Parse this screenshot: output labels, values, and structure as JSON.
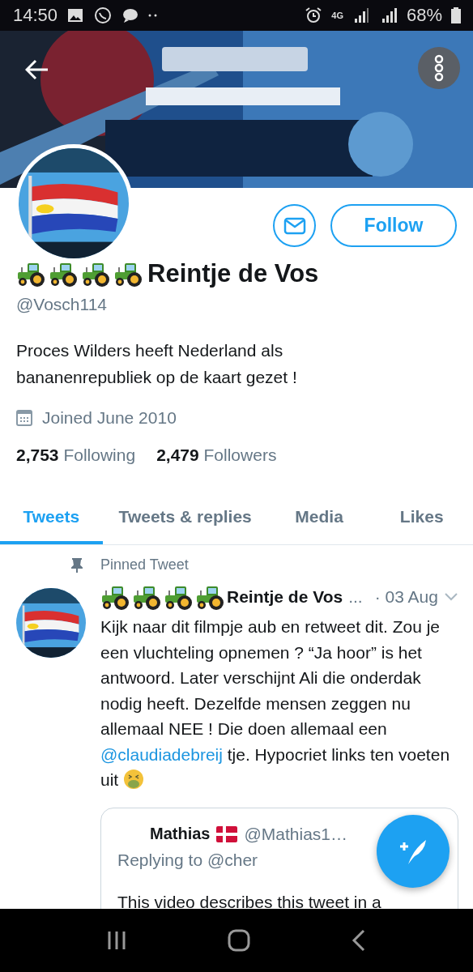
{
  "status_bar": {
    "time": "14:50",
    "network": "4G",
    "battery": "68%"
  },
  "profile": {
    "follow_button": "Follow",
    "name": "Reintje de Vos",
    "handle": "@Vosch114",
    "bio": "Proces Wilders heeft Nederland als bananenrepubliek op de kaart gezet !",
    "joined": "Joined June 2010",
    "stats": [
      {
        "count": "2,753",
        "label": "Following"
      },
      {
        "count": "2,479",
        "label": "Followers"
      }
    ]
  },
  "tabs": [
    {
      "label": "Tweets",
      "selected": true
    },
    {
      "label": "Tweets & replies",
      "selected": false
    },
    {
      "label": "Media",
      "selected": false
    },
    {
      "label": "Likes",
      "selected": false
    }
  ],
  "pinned_label": "Pinned Tweet",
  "tweet": {
    "name": "Reintje de Vos",
    "ellipsis": "...",
    "date": "· 03 Aug",
    "text_parts": [
      {
        "kind": "text",
        "text": "Kijk naar dit filmpje aub en retweet dit. Zou je een vluchteling opnemen ? “Ja hoor”  is het antwoord. Later verschijnt Ali die onderdak nodig heeft. Dezelfde mensen zeggen nu allemaal NEE !  Die doen allemaal een "
      },
      {
        "kind": "mention",
        "text": "@claudiadebreij"
      },
      {
        "kind": "text",
        "text": "  tje. Hypocriet links ten voeten uit "
      }
    ],
    "quote": {
      "name": "Mathias",
      "handle": "@Mathias1…",
      "replying": "Replying to @cher",
      "text": "This video describes this tweet in a"
    }
  }
}
